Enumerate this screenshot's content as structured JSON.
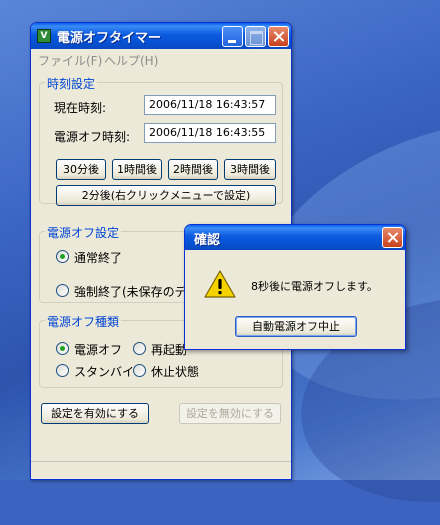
{
  "window": {
    "title": "電源オフタイマー",
    "icon_glyph": "V",
    "menu": [
      "ファイル(F)",
      "ヘルプ(H)"
    ]
  },
  "time_settings": {
    "label": "時刻設定",
    "current_time_label": "現在時刻:",
    "current_time_value": "2006/11/18 16:43:57",
    "poweroff_time_label": "電源オフ時刻:",
    "poweroff_time_value": "2006/11/18 16:43:55",
    "preset_buttons": [
      "30分後",
      "1時間後",
      "2時間後",
      "3時間後"
    ],
    "two_min_button": "2分後(右クリックメニューで設定)"
  },
  "poweroff_settings": {
    "label": "電源オフ設定",
    "options": [
      "通常終了",
      "強制終了(未保存のデ"
    ],
    "selected": 0
  },
  "poweroff_type": {
    "label": "電源オフ種類",
    "options": [
      "電源オフ",
      "再起動",
      "スタンバイ",
      "休止状態"
    ],
    "selected": 0
  },
  "actions": {
    "enable_button": "設定を有効にする",
    "disable_button": "設定を無効にする"
  },
  "dialog": {
    "title": "確認",
    "message": "8秒後に電源オフします。",
    "button": "自動電源オフ中止",
    "icon": "warning-icon"
  },
  "colors": {
    "titlebar": "#0a5ee8",
    "group_label": "#0046d5",
    "window_bg": "#ece9d8",
    "close_button": "#c8401e",
    "warning_yellow": "#f5d300"
  }
}
